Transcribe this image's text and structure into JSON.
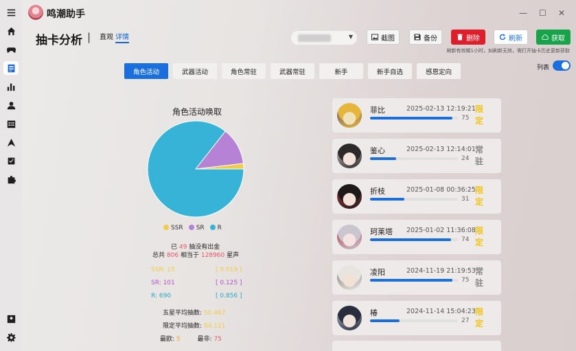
{
  "app": {
    "title": "鸣潮助手"
  },
  "window": {
    "minimize": "—",
    "maximize": "☐",
    "close": "✕"
  },
  "sidebar": {
    "items": [
      {
        "name": "menu-icon"
      },
      {
        "name": "home-icon"
      },
      {
        "name": "gamepad-icon"
      },
      {
        "name": "gacha-analysis-icon",
        "active": true
      },
      {
        "name": "chart-icon"
      },
      {
        "name": "person-icon"
      },
      {
        "name": "calendar-icon"
      },
      {
        "name": "navigation-icon"
      },
      {
        "name": "shield-check-icon"
      },
      {
        "name": "puzzle-icon"
      },
      {
        "name": "account-icon"
      },
      {
        "name": "settings-icon"
      }
    ]
  },
  "header": {
    "page_title": "抽卡分析",
    "separator": "|",
    "view_tabs": [
      {
        "label": "直观"
      },
      {
        "label": "详情",
        "active": true
      }
    ],
    "buttons": {
      "screenshot": "截图",
      "backup": "备份",
      "delete": "删除",
      "refresh": "刷新",
      "fetch": "获取"
    },
    "hint": "刷新有效期1小时，如刷新无效，需打开抽卡历史更新获取"
  },
  "pool_tabs": [
    {
      "label": "角色活动",
      "active": true
    },
    {
      "label": "武器活动"
    },
    {
      "label": "角色常驻"
    },
    {
      "label": "武器常驻"
    },
    {
      "label": "新手"
    },
    {
      "label": "新手自选"
    },
    {
      "label": "感恩定向"
    }
  ],
  "list_toggle": {
    "label": "列表",
    "on": true
  },
  "colors": {
    "ssr": "#f2cc45",
    "sr": "#b582d6",
    "r": "#36b3d6",
    "accent": "#1a6fdc"
  },
  "chart_data": {
    "type": "pie",
    "title": "角色活动唤取",
    "slices": [
      {
        "label": "SSR",
        "value": 15
      },
      {
        "label": "SR",
        "value": 101
      },
      {
        "label": "R",
        "value": 690
      }
    ],
    "legend": [
      "SSR",
      "SR",
      "R"
    ]
  },
  "stats": {
    "pity_prefix": "已",
    "pity_count": "49",
    "pity_suffix": "抽没有出金",
    "total_prefix": "总共",
    "total_pulls": "806",
    "equiv_label": "相当于",
    "astrite": "128960",
    "astrite_unit": "星声",
    "ssr_label": "SSR: 15",
    "ssr_rate": "[ 0.019 ]",
    "sr_label": "SR: 101",
    "sr_rate": "[ 0.125 ]",
    "r_label": "R: 690",
    "r_rate": "[ 0.856 ]",
    "avg_5star_label": "五星平均抽数:",
    "avg_5star_value": "50.467",
    "avg_limited_label": "限定平均抽数:",
    "avg_limited_value": "84.111",
    "luckiest_label": "最欧:",
    "luckiest_value": "5",
    "unluckiest_label": "最非:",
    "unluckiest_value": "75"
  },
  "records": [
    {
      "name": "菲比",
      "time": "2025-02-13 12:19:21",
      "count": 75,
      "kind": "限\n定",
      "limited": true,
      "colors": [
        "#f0e2b8",
        "#e6b63c",
        "#5a4a7a"
      ]
    },
    {
      "name": "鉴心",
      "time": "2025-02-13 12:14:01",
      "count": 24,
      "kind": "常\n驻",
      "limited": false,
      "colors": [
        "#f3e3d9",
        "#2d2a2c",
        "#d6ccc8"
      ]
    },
    {
      "name": "折枝",
      "time": "2025-01-08 00:36:25",
      "count": 31,
      "kind": "限\n定",
      "limited": true,
      "colors": [
        "#f4e1d8",
        "#1e1a1c",
        "#b93b40"
      ]
    },
    {
      "name": "珂莱塔",
      "time": "2025-01-02 11:36:08",
      "count": 74,
      "kind": "限\n定",
      "limited": true,
      "colors": [
        "#f4e3e0",
        "#c9c6cf",
        "#b4303c"
      ]
    },
    {
      "name": "凌阳",
      "time": "2024-11-19 21:19:53",
      "count": 75,
      "kind": "常\n驻",
      "limited": false,
      "colors": [
        "#f2e2d6",
        "#e8e5e0",
        "#7a7670"
      ]
    },
    {
      "name": "椿",
      "time": "2024-11-14 15:04:23",
      "count": 27,
      "kind": "限\n定",
      "limited": true,
      "colors": [
        "#f2e2dd",
        "#2a2d3d",
        "#b9bfd0"
      ]
    }
  ]
}
